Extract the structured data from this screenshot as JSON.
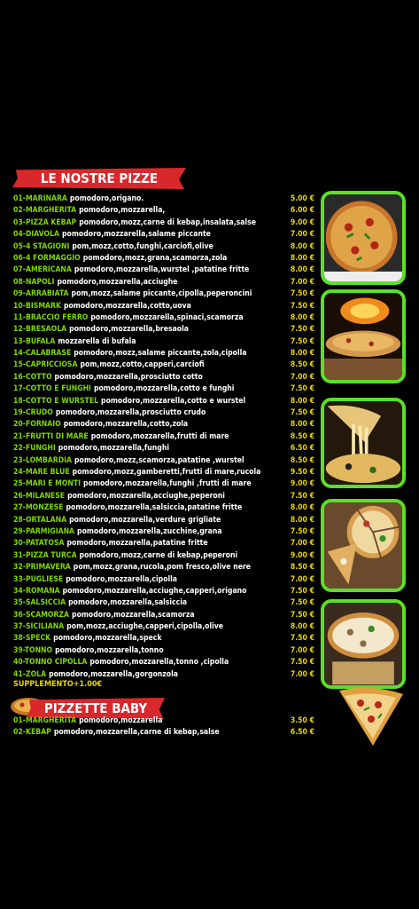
{
  "title": "LE NOSTRE PIZZE",
  "pizze": [
    {
      "code": "01-",
      "name": "MARINARA",
      "ingredients": "pomodoro,origano.",
      "price": "5.00 €"
    },
    {
      "code": "02-",
      "name": "MARGHERITA",
      "ingredients": "pomodoro,mozzarella,",
      "price": "6.00 €"
    },
    {
      "code": "03-",
      "name": "PIZZA KEBAP",
      "ingredients": "pomodoro,mozz,carne di kebap,insalata,salse",
      "price": "9.00 €"
    },
    {
      "code": "04-",
      "name": "DIAVOLA",
      "ingredients": "pomodoro,mozzarella,salame piccante",
      "price": "7.00 €"
    },
    {
      "code": "05-",
      "name": "4 STAGIONI",
      "ingredients": "pom,mozz,cotto,funghi,carciofi,olive",
      "price": "8.00 €"
    },
    {
      "code": "06-",
      "name": "4 FORMAGGIO",
      "ingredients": "pomodoro,mozz,grana,scamorza,zola",
      "price": "8.00 €"
    },
    {
      "code": "07-",
      "name": "AMERICANA",
      "ingredients": "pomodoro,mozzarella,wurstel ,patatine fritte",
      "price": "8.00 €"
    },
    {
      "code": "08-",
      "name": "NAPOLI",
      "ingredients": "pomodoro,mozzarella,acciughe",
      "price": "7.00 €"
    },
    {
      "code": "09-",
      "name": "ARRABIATA",
      "ingredients": "pom,mozz,salame piccante,cipolla,peperoncini",
      "price": "7.50 €"
    },
    {
      "code": "10-",
      "name": "BISMARK",
      "ingredients": "pomodoro,mozzarella,cotto,uova",
      "price": "7.50 €"
    },
    {
      "code": "11-",
      "name": "BRACCIO FERRO",
      "ingredients": "pomodoro,mozzarella,spinaci,scamorza",
      "price": "8.00 €"
    },
    {
      "code": "12-",
      "name": "BRESAOLA",
      "ingredients": "pomodoro,mozzarella,bresaola",
      "price": "7.50 €"
    },
    {
      "code": "13-",
      "name": "BUFALA",
      "ingredients": "mozzarella di bufala",
      "price": "7.50 €"
    },
    {
      "code": "14-",
      "name": "CALABRASE",
      "ingredients": "pomodoro,mozz,salame piccante,zola,cipolla",
      "price": "8.00 €"
    },
    {
      "code": "15-",
      "name": "CAPRICCIOSA",
      "ingredients": "pom,mozz,cotto,capperi,carciofi",
      "price": "8.50 €"
    },
    {
      "code": "16-",
      "name": "COTTO",
      "ingredients": "pomodoro,mozzarella,prosciutto cotto",
      "price": "7.00 €"
    },
    {
      "code": "17-",
      "name": "COTTO E FUNGHI",
      "ingredients": "pomodoro,mozzarella,cotto e funghi",
      "price": "7.50 €"
    },
    {
      "code": "18-",
      "name": "COTTO E WURSTEL",
      "ingredients": "pomodoro,mozzarella,cotto e wurstel",
      "price": "8.00 €"
    },
    {
      "code": "19-",
      "name": "CRUDO",
      "ingredients": "pomodoro,mozzarella,prosciutto crudo",
      "price": "7.50 €"
    },
    {
      "code": "20-",
      "name": "FORNAIO",
      "ingredients": "pomodoro,mozzarella,cotto,zola",
      "price": "8.00 €"
    },
    {
      "code": "21-",
      "name": "FRUTTI DI MARE",
      "ingredients": "pomodoro,mozzarella,frutti di mare",
      "price": "8.50 €"
    },
    {
      "code": "22-",
      "name": "FUNGHI",
      "ingredients": "pomodoro,mozzarella,funghi",
      "price": "6.50 €"
    },
    {
      "code": "23-",
      "name": "LOMBARDIA",
      "ingredients": "pomodoro,mozz,scamorza,patatine ,wurstel",
      "price": "8.50 €"
    },
    {
      "code": "24-",
      "name": "MARE BLUE",
      "ingredients": "pomodoro,mozz,gamberetti,frutti di mare,rucola",
      "price": "9.50 €"
    },
    {
      "code": "25-",
      "name": "MARI E MONTI",
      "ingredients": "pomodoro,mozzarella,funghi ,frutti di mare",
      "price": "9.00 €"
    },
    {
      "code": "26-",
      "name": "MILANESE",
      "ingredients": "pomodoro,mozzarella,acciughe,peperoni",
      "price": "7.50 €"
    },
    {
      "code": "27-",
      "name": "MONZESE",
      "ingredients": "pomodoro,mozzarella,salsiccia,patatine fritte",
      "price": "8.00 €"
    },
    {
      "code": "28-",
      "name": "ORTALANA",
      "ingredients": "pomodoro,mozzarella,verdure grigliate",
      "price": "8.00 €"
    },
    {
      "code": "29-",
      "name": "PARMIGIANA",
      "ingredients": "pomodoro,mozzarella,zucchine,grana",
      "price": "7.50 €"
    },
    {
      "code": "30-",
      "name": "PATATOSA",
      "ingredients": "pomodoro,mozzarella,patatine fritte",
      "price": "7.00 €"
    },
    {
      "code": "31-",
      "name": "PIZZA TURCA",
      "ingredients": "pomodoro,mozz,carne di kebap,peperoni",
      "price": "9.00 €"
    },
    {
      "code": "32-",
      "name": "PRIMAVERA",
      "ingredients": "pom,mozz,grana,rucola,pom fresco,olive nere",
      "price": "8.50 €"
    },
    {
      "code": "33-",
      "name": "PUGLIESE",
      "ingredients": "pomodoro,mozzarella,cipolla",
      "price": "7.00 €"
    },
    {
      "code": "34-",
      "name": "ROMANA",
      "ingredients": "pomodoro,mozzarella,acciughe,capperi,origano",
      "price": "7.50 €"
    },
    {
      "code": "35-",
      "name": "SALSICCIA",
      "ingredients": "pomodoro,mozzarella,salsiccia",
      "price": "7.50 €"
    },
    {
      "code": "36-",
      "name": "SCAMORZA",
      "ingredients": "pomodoro,mozzarella,scamorza",
      "price": "7.50 €"
    },
    {
      "code": "37-",
      "name": "SICILIANA",
      "ingredients": "pom,mozz,acciughe,capperi,cipolla,olive",
      "price": "8.00 €"
    },
    {
      "code": "38-",
      "name": "SPECK",
      "ingredients": "pomodoro,mozzarella,speck",
      "price": "7.50 €"
    },
    {
      "code": "39-",
      "name": "TONNO",
      "ingredients": "pomodoro,mozzarella,tonno",
      "price": "7.00 €"
    },
    {
      "code": "40-",
      "name": "TONNO CIPOLLA",
      "ingredients": "pomodoro,mozzarella,tonno ,cipolla",
      "price": "7.50 €"
    },
    {
      "code": "41-",
      "name": "ZOLA",
      "ingredients": "pomodoro,mozzarella,gorgonzola",
      "price": "7.00 €"
    }
  ],
  "supplemento": "SUPPLEMENTO+1.00€",
  "baby_title": "PIZZETTE BABY",
  "baby": [
    {
      "code": "01-",
      "name": "MARGHERITA",
      "ingredients": "pomodoro,mozzarella",
      "price": "3.50 €"
    },
    {
      "code": "02-",
      "name": "KEBAP",
      "ingredients": "pomodoro,mozzarella,carne di kebap,salse",
      "price": "6.50 €"
    }
  ],
  "colors": {
    "accent": "#7fd800",
    "price": "#e8d400",
    "banner": "#d8282c",
    "frame": "#5bdf27"
  }
}
